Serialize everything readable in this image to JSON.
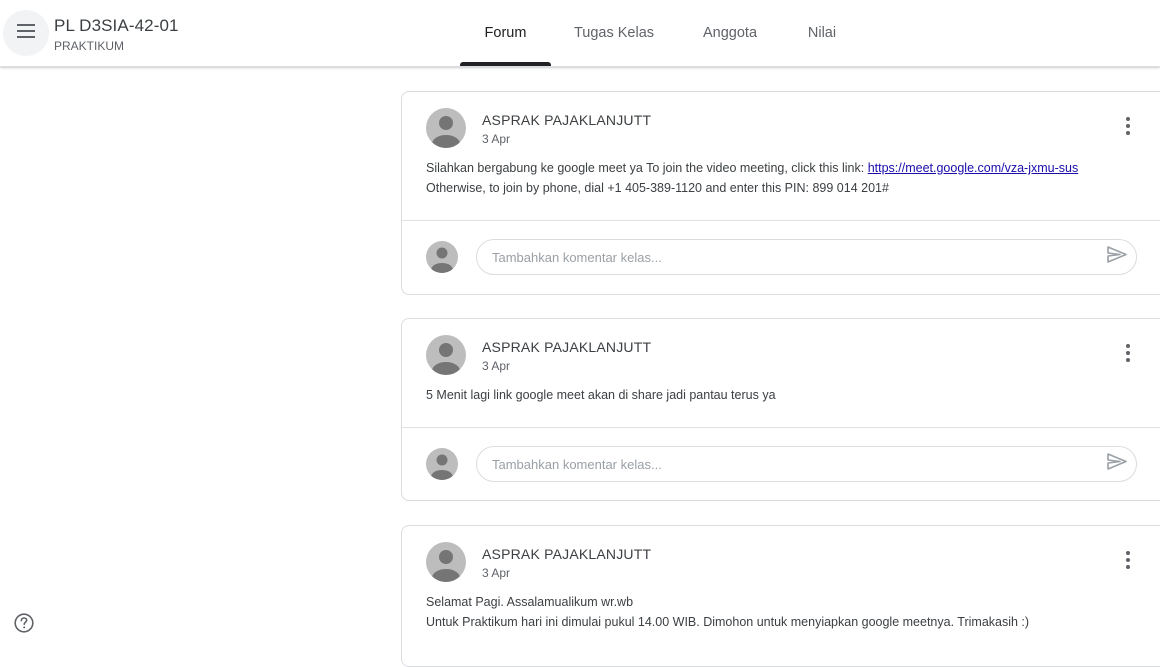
{
  "header": {
    "class_title": "PL D3SIA-42-01",
    "class_subtitle": "PRAKTIKUM",
    "tabs": [
      {
        "label": "Forum",
        "active": true
      },
      {
        "label": "Tugas Kelas",
        "active": false
      },
      {
        "label": "Anggota",
        "active": false
      },
      {
        "label": "Nilai",
        "active": false
      }
    ]
  },
  "posts": [
    {
      "author": "ASPRAK PAJAKLANJUTT",
      "date": "3 Apr",
      "body_line1": "Silahkan bergabung ke google meet ya To join the video meeting, click this link: ",
      "body_link": "https://meet.google.com/vza-jxmu-sus",
      "body_line2": "Otherwise, to join by phone, dial +1 405-389-1120 and enter this PIN: 899 014 201#",
      "comment_placeholder": "Tambahkan komentar kelas..."
    },
    {
      "author": "ASPRAK PAJAKLANJUTT",
      "date": "3 Apr",
      "body_line1": "5 Menit lagi link google meet akan di share jadi pantau terus ya",
      "comment_placeholder": "Tambahkan komentar kelas..."
    },
    {
      "author": "ASPRAK PAJAKLANJUTT",
      "date": "3 Apr",
      "body_line1": "Selamat Pagi. Assalamualikum wr.wb",
      "body_line2": "Untuk Praktikum hari ini dimulai pukul 14.00 WIB. Dimohon untuk menyiapkan google meetnya. Trimakasih :)"
    }
  ],
  "icons": {
    "menu": "hamburger-menu-icon",
    "more": "more-vert-icon",
    "send": "send-icon",
    "help": "help-icon",
    "avatar": "default-avatar"
  },
  "colors": {
    "active_tab_indicator": "#202124",
    "link": "#1a0dab",
    "avatar_bg": "#bdbdbd",
    "avatar_fg": "#757575",
    "top_accent": "#7cb342"
  }
}
